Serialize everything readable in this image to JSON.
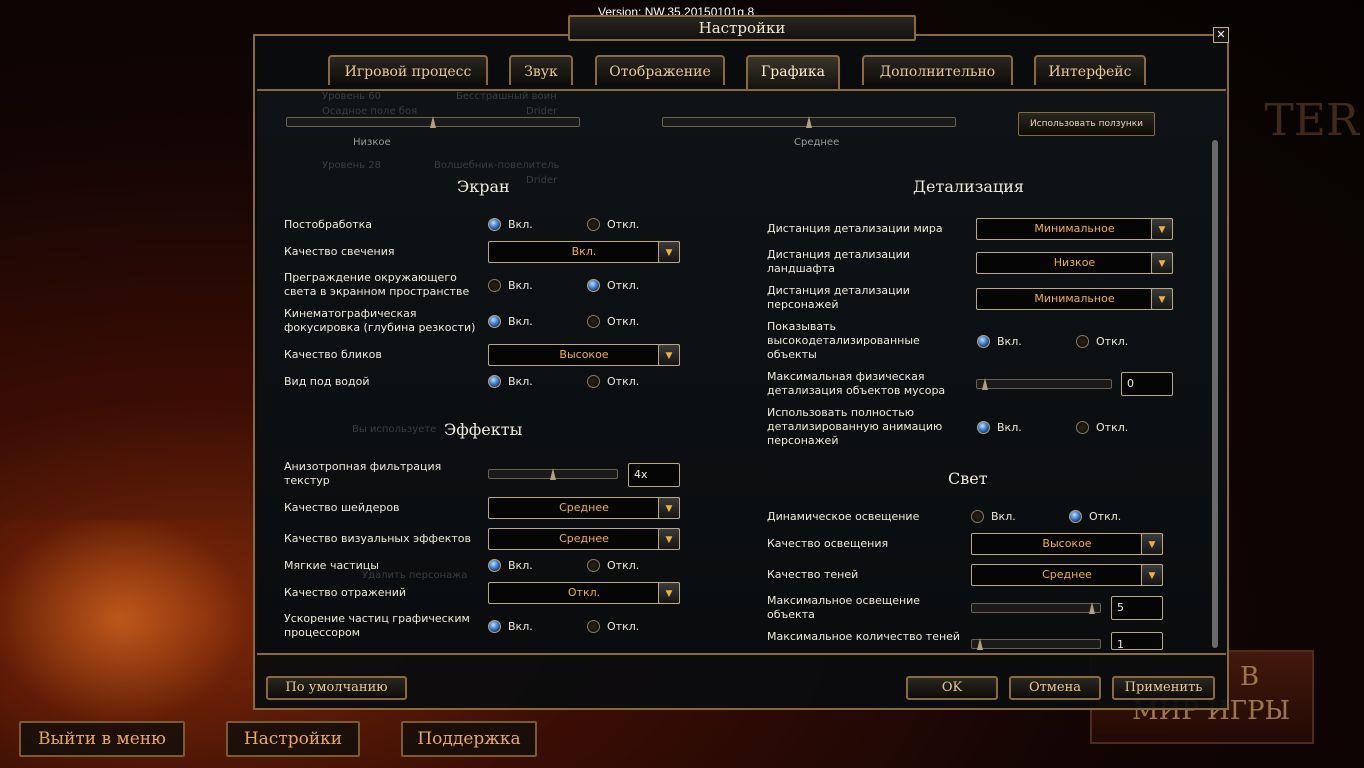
{
  "version": "Version: NW.35.20150101g.8",
  "title": "Настройки",
  "close": "✕",
  "tabs": [
    "Игровой процесс",
    "Звук",
    "Отображение",
    "Графика",
    "Дополнительно",
    "Интерфейс"
  ],
  "active_tab": "Графика",
  "background": {
    "ghost_rows": [
      "Уровень 60",
      "Бесстрашный воин",
      "Осадное поле боя",
      "Drider",
      "Уровень 28",
      "Волшебник-повелитель",
      "Drider",
      "Вы используете",
      "Удалить персонажа"
    ],
    "banner_lines": [
      "В",
      "МИР ИГРЫ"
    ],
    "logo_text": "TER"
  },
  "presets": {
    "left_value": "Низкое",
    "right_value": "Среднее",
    "use_sliders_label": "Использовать ползунки",
    "left_level": 0.5,
    "right_level": 0.5
  },
  "screen": {
    "title": "Экран",
    "postprocess": {
      "label": "Постобработка",
      "on": "Вкл.",
      "off": "Откл.",
      "selected": "on"
    },
    "glow": {
      "label": "Качество свечения",
      "value": "Вкл."
    },
    "ssao": {
      "label1": "Преграждение окружающего",
      "label2": "света в экранном пространстве",
      "on": "Вкл.",
      "off": "Откл.",
      "selected": "off"
    },
    "dof": {
      "label1": "Кинематографическая",
      "label2": "фокусировка (глубина резкости)",
      "on": "Вкл.",
      "off": "Откл.",
      "selected": "on"
    },
    "glare": {
      "label": "Качество бликов",
      "value": "Высокое"
    },
    "underwater": {
      "label": "Вид под водой",
      "on": "Вкл.",
      "off": "Откл.",
      "selected": "on"
    }
  },
  "effects": {
    "title": "Эффекты",
    "aniso": {
      "label1": "Анизотропная фильтрация",
      "label2": "текстур",
      "value": "4x",
      "level": 0.5
    },
    "shaders": {
      "label": "Качество шейдеров",
      "value": "Среднее"
    },
    "vfx": {
      "label": "Качество визуальных эффектов",
      "value": "Среднее"
    },
    "soft": {
      "label": "Мягкие частицы",
      "on": "Вкл.",
      "off": "Откл.",
      "selected": "on"
    },
    "reflect": {
      "label": "Качество отражений",
      "value": "Откл."
    },
    "gpu": {
      "label1": "Ускорение частиц графическим",
      "label2": "процессором",
      "on": "Вкл.",
      "off": "Откл.",
      "selected": "on"
    }
  },
  "detail": {
    "title": "Детализация",
    "world": {
      "label": "Дистанция детализации мира",
      "value": "Минимальное"
    },
    "terrain": {
      "label1": "Дистанция детализации",
      "label2": "ландшафта",
      "value": "Низкое"
    },
    "chars": {
      "label1": "Дистанция детализации",
      "label2": "персонажей",
      "value": "Минимальное"
    },
    "hiobj": {
      "label1": "Показывать",
      "label2": "высокодетализированные",
      "label3": "объекты",
      "on": "Вкл.",
      "off": "Откл.",
      "selected": "on"
    },
    "debris": {
      "label1": "Максимальная физическая",
      "label2": "детализация объектов мусора",
      "value": "0",
      "level": 0
    },
    "anim": {
      "label1": "Использовать полностью",
      "label2": "детализированную анимацию",
      "label3": "персонажей",
      "on": "Вкл.",
      "off": "Откл.",
      "selected": "on"
    }
  },
  "light": {
    "title": "Свет",
    "dynamic": {
      "label": "Динамическое освещение",
      "on": "Вкл.",
      "off": "Откл.",
      "selected": "off"
    },
    "quality": {
      "label": "Качество освещения",
      "value": "Высокое"
    },
    "shadows": {
      "label": "Качество теней",
      "value": "Среднее"
    },
    "maxlight": {
      "label1": "Максимальное освещение",
      "label2": "объекта",
      "value": "5",
      "level": 1
    },
    "maxshadow": {
      "label": "Максимальное количество теней",
      "value": "1",
      "level": 0
    }
  },
  "buttons": {
    "defaults": "По умолчанию",
    "ok": "OK",
    "cancel": "Отмена",
    "apply": "Применить"
  },
  "bottom": {
    "exit": "Выйти в меню",
    "settings": "Настройки",
    "support": "Поддержка"
  },
  "colors": {
    "accent": "#8a6a3a",
    "value_text": "#f0b040",
    "selected_radio": "#3a7ad0"
  }
}
